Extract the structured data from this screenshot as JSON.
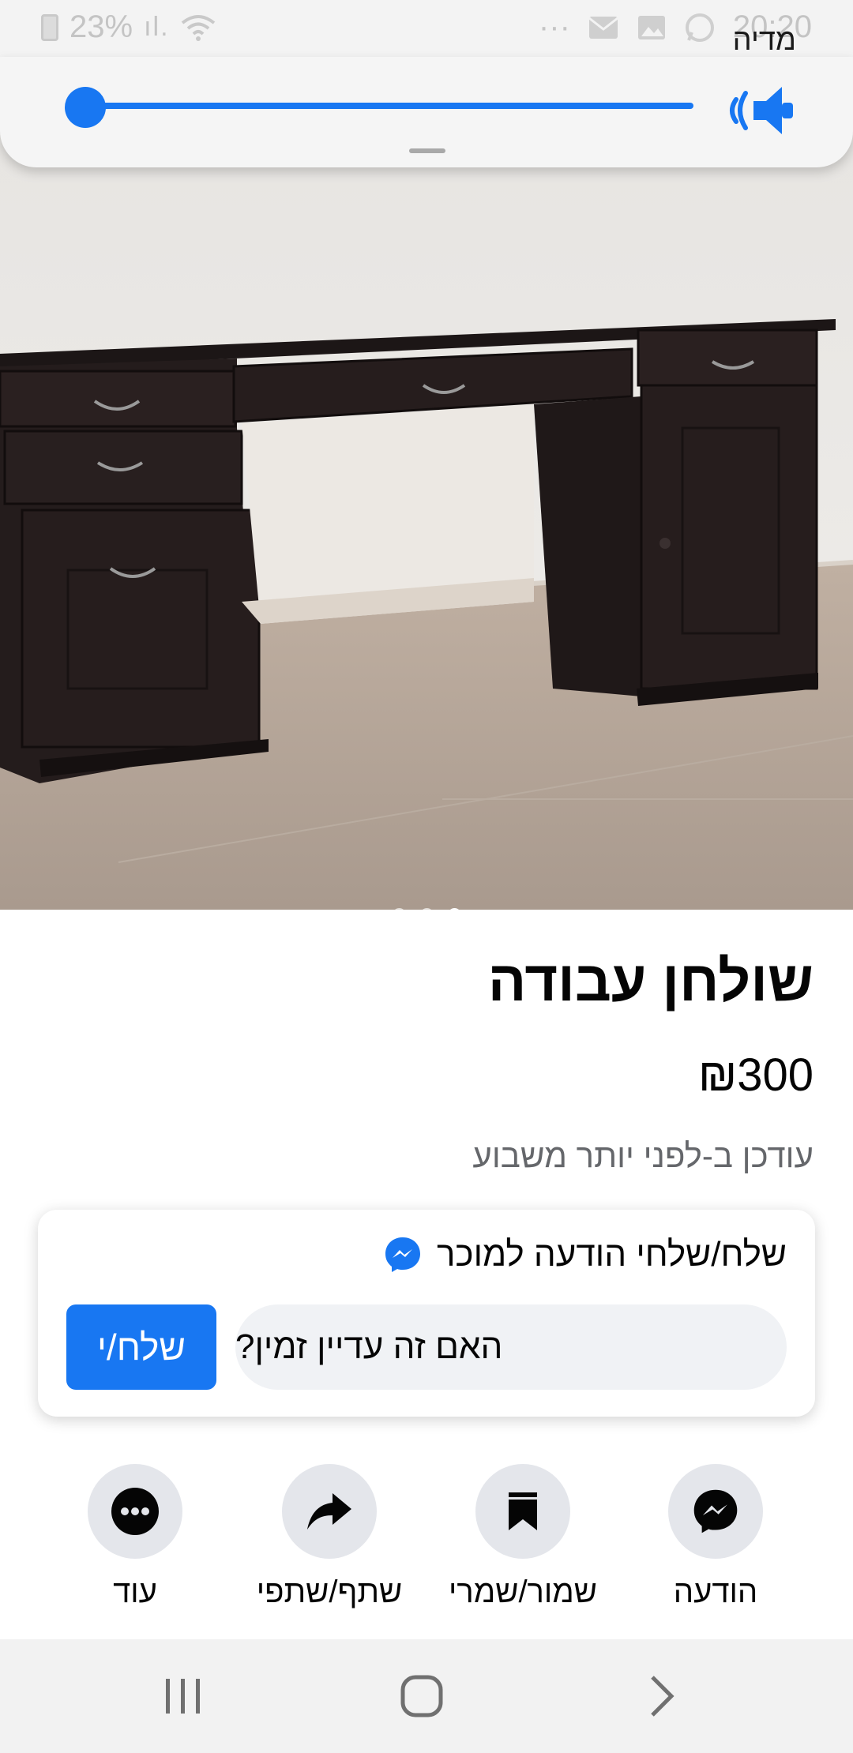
{
  "status_bar": {
    "battery": "23%",
    "time": "20:20",
    "icons": [
      "battery-icon",
      "signal-icon",
      "wifi-icon",
      "more-icon",
      "email-icon",
      "gallery-icon",
      "whatsapp-icon"
    ]
  },
  "volume_panel": {
    "label": "מדיה",
    "level": 0.0,
    "icon": "speaker-icon",
    "accent": "#1877f2"
  },
  "photo": {
    "page_count": 3,
    "active_index": 2
  },
  "listing": {
    "title": "שולחן עבודה",
    "price": "₪300",
    "updated": "עודכן ב-לפני יותר משבוע"
  },
  "message": {
    "header": "שלח/שלחי הודעה למוכר",
    "input_value": "האם זה עדיין זמין?",
    "send_label": "שלח/י"
  },
  "actions": [
    {
      "label": "הודעה",
      "icon": "messenger-icon"
    },
    {
      "label": "שמור/שמרי",
      "icon": "bookmark-icon"
    },
    {
      "label": "שתף/שתפי",
      "icon": "share-icon"
    },
    {
      "label": "עוד",
      "icon": "more-icon"
    }
  ],
  "nav": [
    "recent-apps-icon",
    "home-icon",
    "back-icon"
  ]
}
